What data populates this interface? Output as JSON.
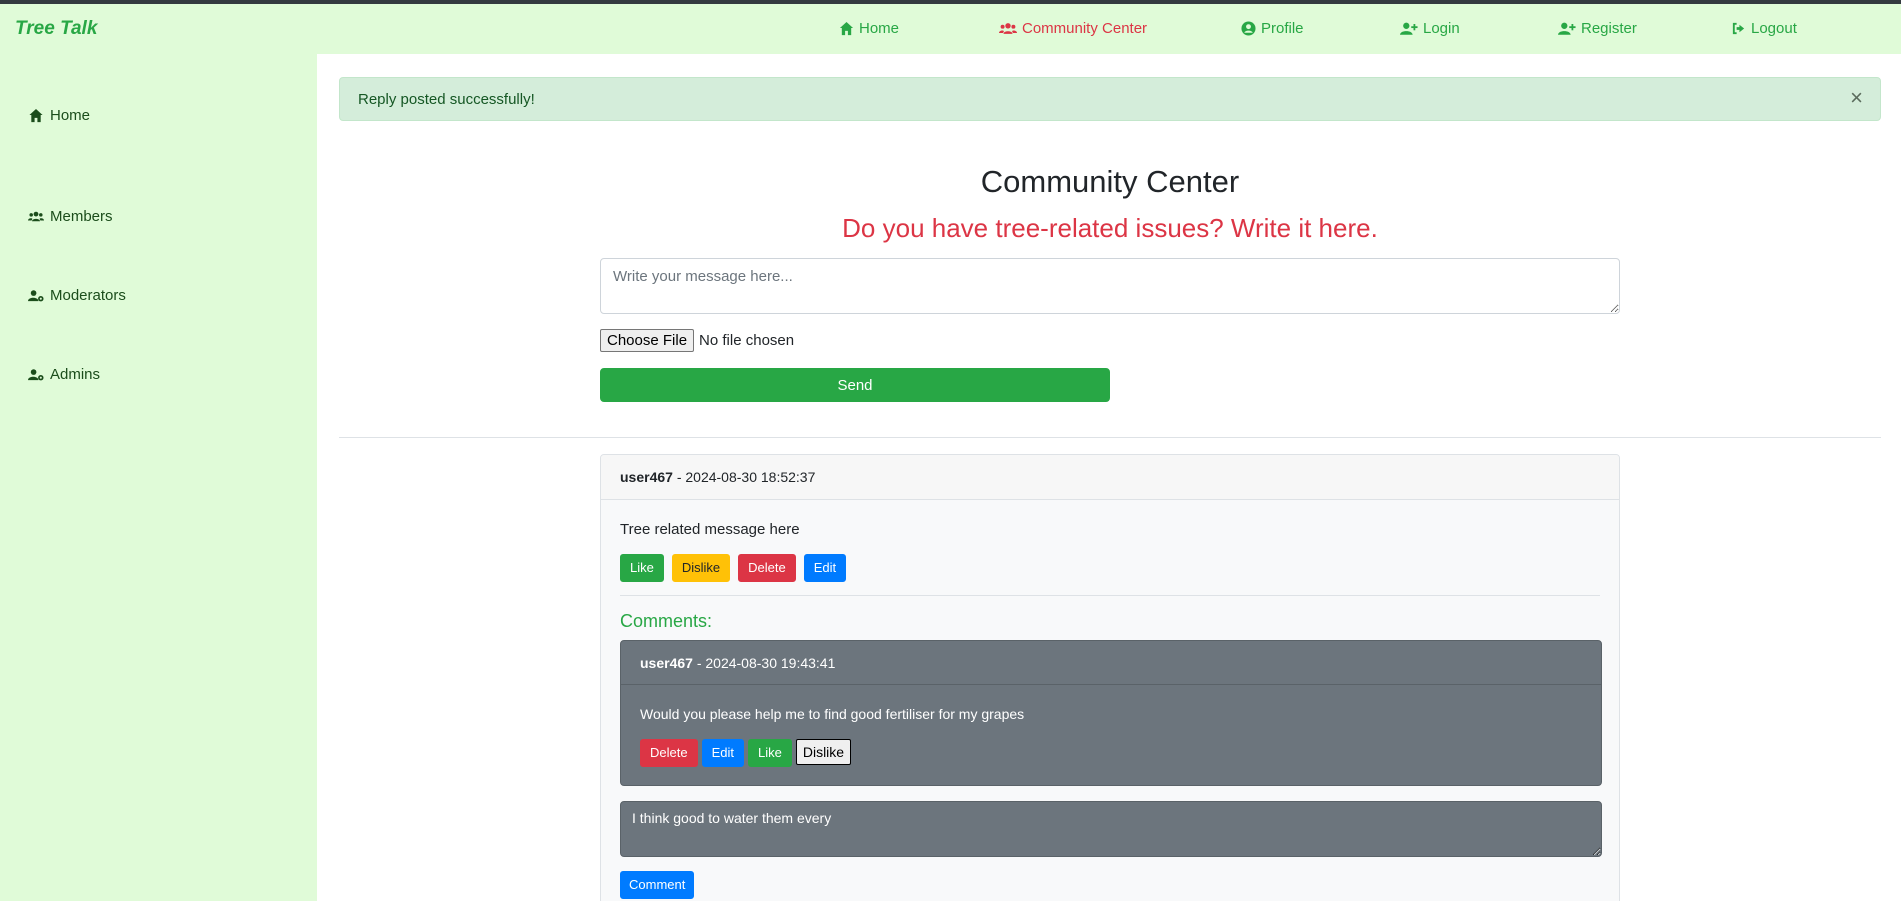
{
  "navbar": {
    "brand": "Tree Talk",
    "items": [
      {
        "label": "Home",
        "icon": "home-icon"
      },
      {
        "label": "Community Center",
        "icon": "users-icon",
        "active": true
      },
      {
        "label": "Profile",
        "icon": "user-circle-icon"
      },
      {
        "label": "Login",
        "icon": "user-plus-icon"
      },
      {
        "label": "Register",
        "icon": "user-plus-icon"
      },
      {
        "label": "Logout",
        "icon": "sign-out-icon"
      }
    ]
  },
  "sidebar": {
    "items": [
      {
        "label": "Home",
        "icon": "home-icon"
      },
      {
        "label": "Members",
        "icon": "users-icon"
      },
      {
        "label": "Moderators",
        "icon": "user-cog-icon"
      },
      {
        "label": "Admins",
        "icon": "user-cog-icon"
      }
    ]
  },
  "alert": {
    "message": "Reply posted successfully!",
    "close": "×"
  },
  "main": {
    "title": "Community Center",
    "subtitle": "Do you have tree-related issues? Write it here.",
    "message_placeholder": "Write your message here...",
    "file_button": "Choose File",
    "file_status": "No file chosen",
    "send_label": "Send"
  },
  "post": {
    "user": "user467",
    "timestamp": "- 2024-08-30 18:52:37",
    "text": "Tree related message here",
    "actions": {
      "like": "Like",
      "dislike": "Dislike",
      "delete": "Delete",
      "edit": "Edit"
    },
    "comments_title": "Comments:",
    "comment": {
      "user": "user467",
      "timestamp": "- 2024-08-30 19:43:41",
      "text": "Would you please help me to find good fertiliser for my grapes",
      "actions": {
        "delete": "Delete",
        "edit": "Edit",
        "like": "Like",
        "dislike": "Dislike"
      }
    },
    "comment_input_value": "I think good to water them every",
    "comment_button": "Comment"
  },
  "colors": {
    "nav_bg": "#e0fbd8",
    "accent_green": "#28a745",
    "accent_red": "#dc3545",
    "primary_blue": "#007bff",
    "warning_yellow": "#ffc107",
    "comment_bg": "#6c757d"
  }
}
